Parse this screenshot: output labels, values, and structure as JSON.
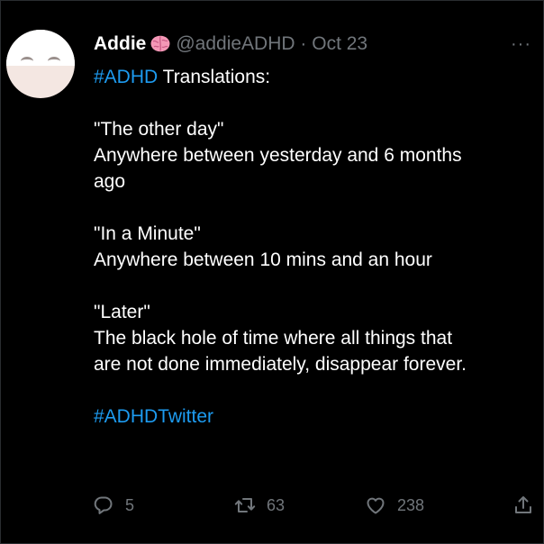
{
  "tweet": {
    "display_name": "Addie",
    "handle": "@addieADHD",
    "separator": "·",
    "date": "Oct 23",
    "more_label": "···",
    "text": {
      "hashtag_1": "#ADHD",
      "title_rest": " Translations:",
      "quote_1": "\"The other day\"",
      "meaning_1_line_1": "Anywhere between yesterday and 6 months",
      "meaning_1_line_2": "ago",
      "quote_2": "\"In a Minute\"",
      "meaning_2": "Anywhere between 10 mins and an hour",
      "quote_3": "\"Later\"",
      "meaning_3_line_1": "The black hole of time where all things that",
      "meaning_3_line_2": "are not done immediately, disappear forever.",
      "hashtag_2": "#ADHDTwitter"
    },
    "stats": {
      "replies": "5",
      "retweets": "63",
      "likes": "238"
    }
  },
  "icons": {
    "verified_emoji": "brain-emoji",
    "reply": "reply-icon",
    "retweet": "retweet-icon",
    "like": "heart-icon",
    "share": "share-icon",
    "more": "more-icon"
  },
  "colors": {
    "background": "#000000",
    "text_primary": "#ffffff",
    "text_secondary": "#71767b",
    "accent": "#1d9bf0",
    "brain": "#f497b6"
  }
}
